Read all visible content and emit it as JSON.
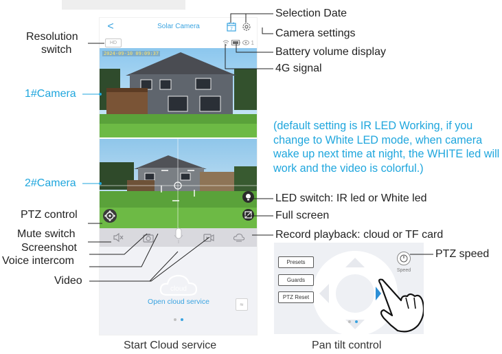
{
  "app": {
    "back_label": "<",
    "title": "Solar Camera",
    "date_icon_text": "7",
    "hd_label": "HD",
    "signal_count": "1",
    "timestamp": "2024-09-10 09:09:37"
  },
  "toolbar": {
    "items": [
      "mute",
      "screenshot",
      "voice-intercom",
      "video",
      "record-playback"
    ]
  },
  "cloud": {
    "icon_text": "cloud",
    "open_label": "Open cloud service",
    "up_icon": "≈"
  },
  "pan_tilt": {
    "buttons": [
      "Presets",
      "Guards",
      "PTZ Reset"
    ],
    "speed_label": "Speed"
  },
  "annotations": {
    "selection_date": "Selection Date",
    "camera_settings": "Camera settings",
    "battery": "Battery volume display",
    "signal_4g": "4G signal",
    "resolution_switch_line1": "Resolution",
    "resolution_switch_line2": "switch",
    "camera1": "1#Camera",
    "camera2": "2#Camera",
    "ptz_control": "PTZ control",
    "mute_switch": "Mute switch",
    "screenshot": "Screenshot",
    "voice_intercom": "Voice intercom",
    "video": "Video",
    "led_switch": "LED switch: IR led or White led",
    "full_screen": "Full screen",
    "record_playback": "Record playback: cloud or TF card",
    "ptz_speed": "PTZ speed",
    "note": "(default setting is IR LED Working, if you change to White LED mode, when camera wake up next time at night, the WHITE led will work and the video is colorful.)"
  },
  "captions": {
    "left": "Start Cloud service",
    "right": "Pan tilt control"
  },
  "colors": {
    "accent": "#39a3e0",
    "annotation_blue": "#1fa6dd",
    "toolbar": "#d9d9de",
    "panel": "#f1f2f6"
  }
}
